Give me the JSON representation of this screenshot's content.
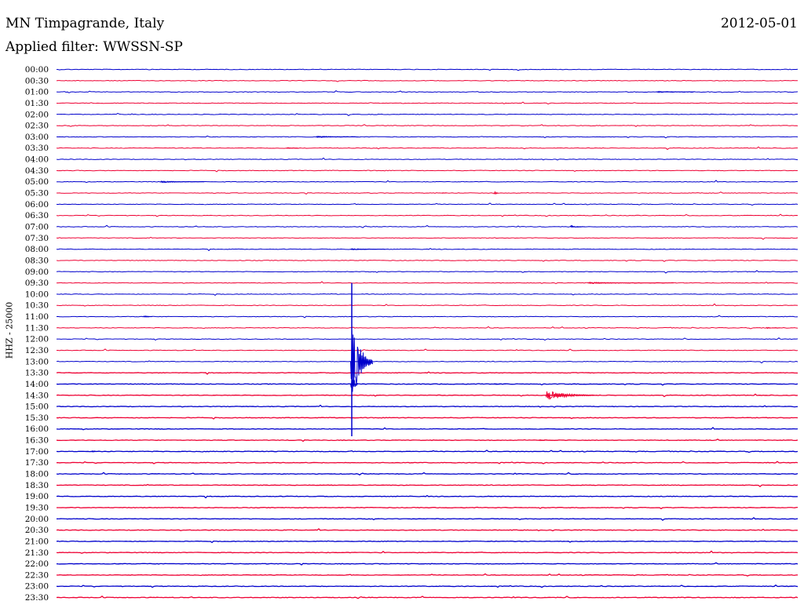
{
  "header": {
    "station": "MN Timpagrande, Italy",
    "date": "2012-05-01",
    "filter": "Applied filter: WWSSN-SP",
    "channel": "HHZ - 25000"
  },
  "colors": {
    "trace_a": "#0000cc",
    "trace_b": "#ee0033",
    "background": "#ffffff"
  },
  "chart_data": {
    "type": "line",
    "title": "MN Timpagrande, Italy",
    "subtitle": "Applied filter: WWSSN-SP",
    "ylabel": "HHZ - 25000",
    "rows": [
      "00:00",
      "00:30",
      "01:00",
      "01:30",
      "02:00",
      "02:30",
      "03:00",
      "03:30",
      "04:00",
      "04:30",
      "05:00",
      "05:30",
      "06:00",
      "06:30",
      "07:00",
      "07:30",
      "08:00",
      "08:30",
      "09:00",
      "09:30",
      "10:00",
      "10:30",
      "11:00",
      "11:30",
      "12:00",
      "12:30",
      "13:00",
      "13:30",
      "14:00",
      "14:30",
      "15:00",
      "15:30",
      "16:00",
      "16:30",
      "17:00",
      "17:30",
      "18:00",
      "18:30",
      "19:00",
      "19:30",
      "20:00",
      "20:30",
      "21:00",
      "21:30",
      "22:00",
      "22:30",
      "23:00",
      "23:30"
    ],
    "row_minutes": 30,
    "series_colors": [
      "#0000cc",
      "#ee0033"
    ],
    "events": [
      {
        "row": "01:00",
        "minute": 24.3,
        "amp": 0.12,
        "duration": 1.5
      },
      {
        "row": "03:00",
        "minute": 10.5,
        "amp": 0.14,
        "duration": 1.7
      },
      {
        "row": "03:30",
        "minute": 9.3,
        "amp": 0.12,
        "duration": 0.5
      },
      {
        "row": "05:00",
        "minute": 4.2,
        "amp": 0.15,
        "duration": 1.8
      },
      {
        "row": "05:30",
        "minute": 17.7,
        "amp": 0.5,
        "duration": 0.2
      },
      {
        "row": "05:30",
        "minute": 15.6,
        "amp": 0.15,
        "duration": 0.2
      },
      {
        "row": "07:00",
        "minute": 20.8,
        "amp": 0.12,
        "duration": 0.6
      },
      {
        "row": "08:00",
        "minute": 11.9,
        "amp": 0.12,
        "duration": 1.4
      },
      {
        "row": "09:30",
        "minute": 21.5,
        "amp": 0.12,
        "duration": 3.5
      },
      {
        "row": "11:00",
        "minute": 3.5,
        "amp": 0.2,
        "duration": 0.4
      },
      {
        "row": "11:30",
        "minute": 28.7,
        "amp": 0.12,
        "duration": 0.6
      },
      {
        "row": "13:00",
        "minute": 11.9,
        "amp": 8.0,
        "duration": 0.9
      },
      {
        "row": "14:00",
        "minute": 11.9,
        "amp": 3.0,
        "duration": 0.3
      },
      {
        "row": "14:00",
        "minute": 17.7,
        "amp": 0.12,
        "duration": 0.5
      },
      {
        "row": "14:30",
        "minute": 19.8,
        "amp": 0.9,
        "duration": 2.0
      },
      {
        "row": "16:30",
        "minute": 19.5,
        "amp": 0.12,
        "duration": 0.6
      },
      {
        "row": "17:00",
        "minute": 1.4,
        "amp": 0.2,
        "duration": 0.3
      },
      {
        "row": "22:00",
        "minute": 2.5,
        "amp": 0.25,
        "duration": 0.1
      }
    ]
  }
}
